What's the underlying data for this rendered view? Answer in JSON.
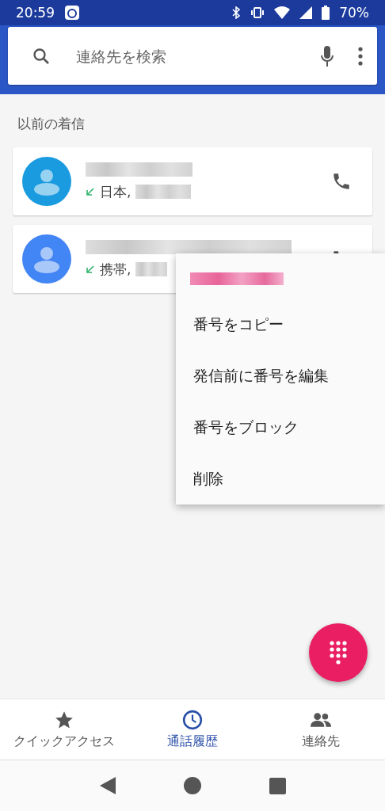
{
  "status_bar": {
    "time": "20:59",
    "battery": "70%"
  },
  "search": {
    "placeholder": "連絡先を検索"
  },
  "section_title": "以前の着信",
  "calls": [
    {
      "color": "#1a9be0",
      "location": "日本,"
    },
    {
      "color": "#4285f4",
      "location": "携帯,"
    }
  ],
  "menu": {
    "items": [
      "番号をコピー",
      "発信前に番号を編集",
      "番号をブロック",
      "削除"
    ]
  },
  "bottom_nav": [
    {
      "label": "クイックアクセス",
      "selected": false
    },
    {
      "label": "通話履歴",
      "selected": true
    },
    {
      "label": "連絡先",
      "selected": false
    }
  ]
}
